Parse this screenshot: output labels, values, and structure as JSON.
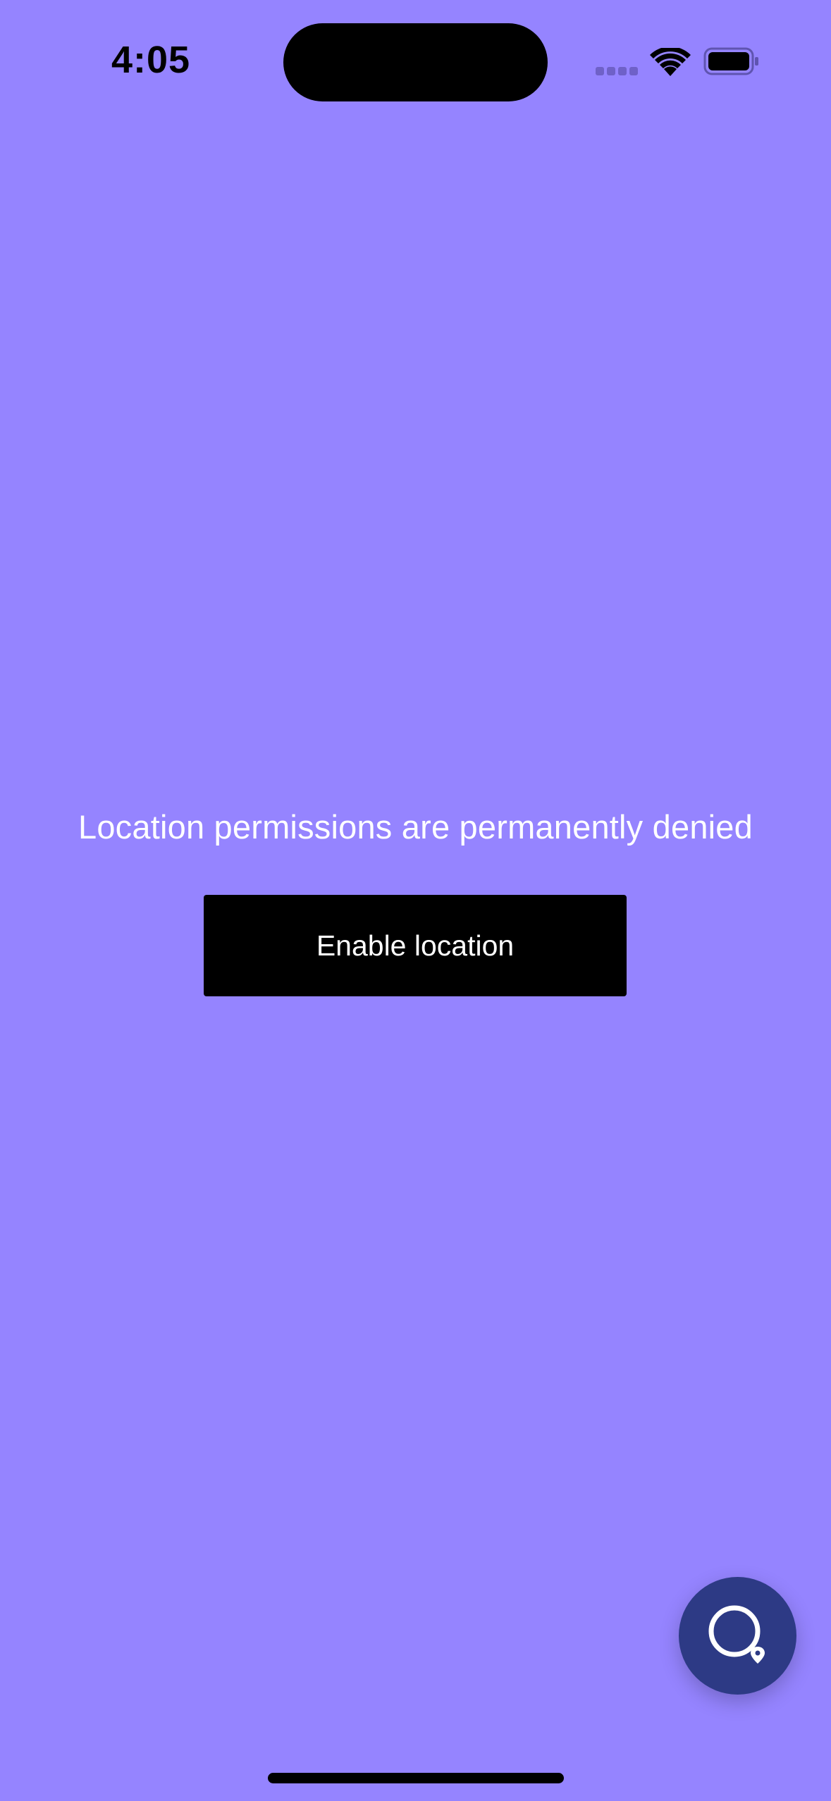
{
  "status_bar": {
    "time": "4:05",
    "icons": [
      "cellular-signal-icon",
      "wifi-icon",
      "battery-icon"
    ]
  },
  "main": {
    "message": "Location permissions are permanently denied",
    "enable_button_label": "Enable location"
  },
  "fab": {
    "icon": "location-search-icon"
  },
  "colors": {
    "background": "#9584FF",
    "button": "#000000",
    "button_text": "#FFFFFF",
    "message_text": "#FFFFFF",
    "fab_background": "#2D3A85"
  }
}
